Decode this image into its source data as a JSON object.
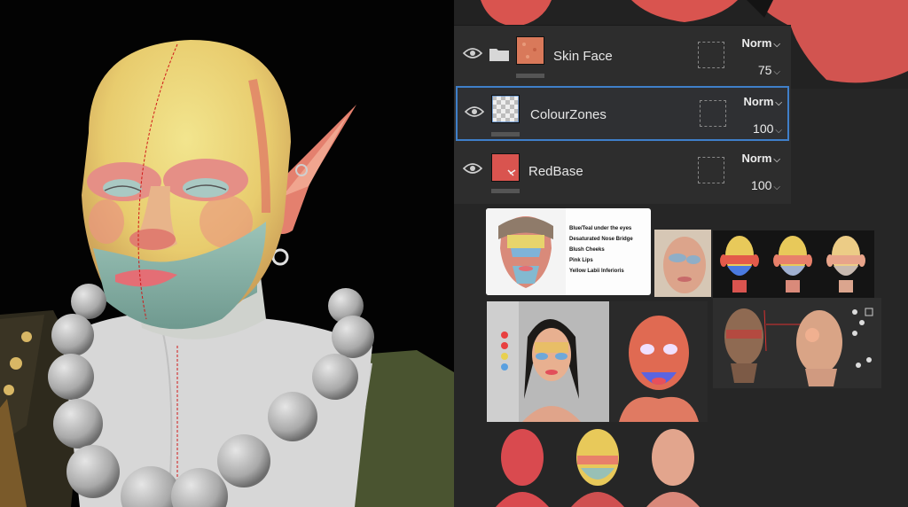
{
  "viewport": {
    "subject": "sculpted character bust with colour-zone painting"
  },
  "layers_panel": {
    "layers": [
      {
        "name": "Skin Face",
        "blend_mode": "Norm",
        "opacity": "75",
        "selected": false,
        "has_folder": true
      },
      {
        "name": "ColourZones",
        "blend_mode": "Norm",
        "opacity": "100",
        "selected": true,
        "has_folder": false
      },
      {
        "name": "RedBase",
        "blend_mode": "Norm",
        "opacity": "100",
        "selected": false,
        "has_folder": false
      }
    ]
  },
  "reference_board": {
    "notes_card": {
      "lines": [
        "Blue/Teal under the eyes",
        "Desaturated Nose Bridge",
        "Blush Cheeks",
        "Pink Lips",
        "Yellow Labii Inferioris"
      ]
    }
  },
  "icons": [
    "eye-icon",
    "folder-icon",
    "chevron-down-icon",
    "layer-mask-placeholder"
  ],
  "colors": {
    "panel_bg": "#2d2d2d",
    "board_bg": "#262626",
    "selection_border": "#3f7fc9",
    "skin_red": "#d9544f",
    "zone_yellow": "#e8cf6a",
    "zone_teal": "#8fb7ae"
  }
}
